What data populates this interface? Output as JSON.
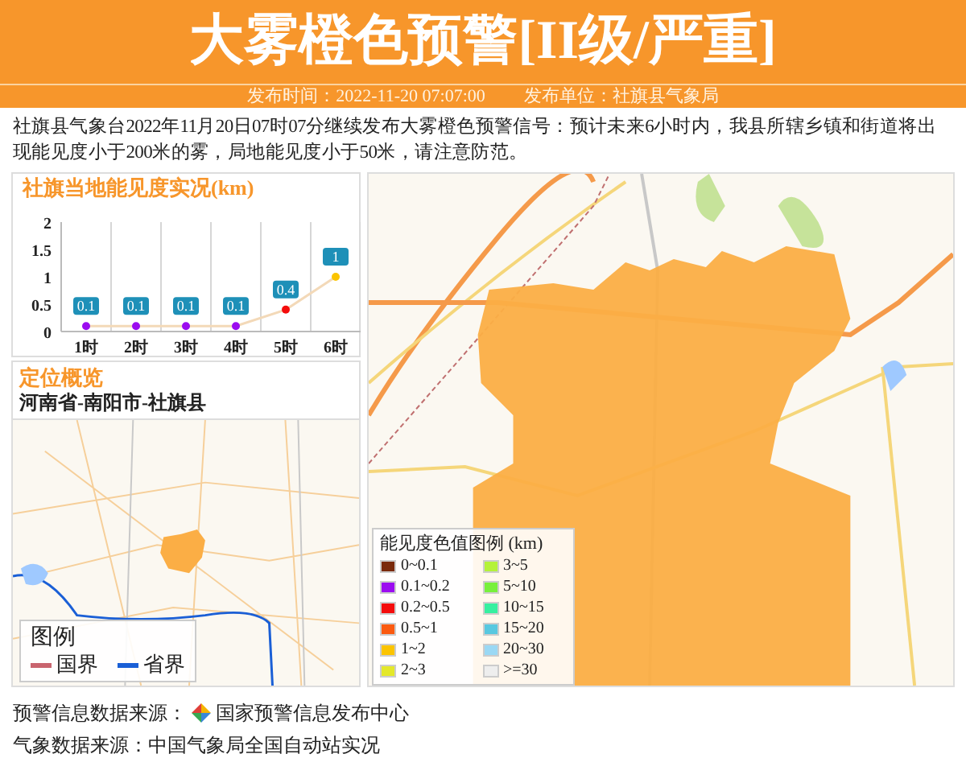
{
  "header": {
    "title": "大雾橙色预警[II级/严重]",
    "publish_time": "发布时间：2022-11-20 07:07:00",
    "publisher": "发布单位：社旗县气象局"
  },
  "description": "社旗县气象台2022年11月20日07时07分继续发布大雾橙色预警信号：预计未来6小时内，我县所辖乡镇和街道将出现能见度小于200米的雾，局地能见度小于50米，请注意防范。",
  "visibility_panel": {
    "title": "社旗当地能见度实况(km)",
    "chart_data": {
      "type": "line",
      "categories": [
        "1时",
        "2时",
        "3时",
        "4时",
        "5时",
        "6时"
      ],
      "series": [
        {
          "color": "#f3d9b8",
          "marker": true,
          "values": [
            0.1,
            0.1,
            0.1,
            0.1,
            0.4,
            1
          ]
        }
      ],
      "ylim": [
        0,
        2
      ],
      "yticks": [
        0,
        {
          "value": 0.5,
          "label": "0.5"
        },
        1,
        {
          "value": 1.5,
          "label": "1.5"
        },
        2
      ],
      "data_labels": true
    }
  },
  "location_panel": {
    "title": "定位概览",
    "region": "河南省-南阳市-社旗县",
    "legend": {
      "title": "图例",
      "items": [
        {
          "label": "国界",
          "color": "#c9646e"
        },
        {
          "label": "省界",
          "color": "#1a5fd6"
        }
      ]
    }
  },
  "visibility_legend": {
    "title": "能见度色值图例 (km)",
    "items": [
      {
        "label": "0~0.1",
        "color": "#7a2a0c"
      },
      {
        "label": "0.1~0.2",
        "color": "#9b0cf0"
      },
      {
        "label": "0.2~0.5",
        "color": "#f40c0c"
      },
      {
        "label": "0.5~1",
        "color": "#fb5a10"
      },
      {
        "label": "1~2",
        "color": "#fbc400"
      },
      {
        "label": "2~3",
        "color": "#e4e82a"
      },
      {
        "label": "3~5",
        "color": "#b4f23a"
      },
      {
        "label": "5~10",
        "color": "#78f03c"
      },
      {
        "label": "10~15",
        "color": "#36f0a0"
      },
      {
        "label": "15~20",
        "color": "#58c8e0"
      },
      {
        "label": "20~30",
        "color": "#9ad8f4"
      },
      {
        "label": ">=30",
        "color": "#eeeeee"
      }
    ]
  },
  "footer": [
    "预警信息数据来源：",
    "国家预警信息发布中心",
    "气象数据来源：中国气象局全国自动站实况"
  ]
}
